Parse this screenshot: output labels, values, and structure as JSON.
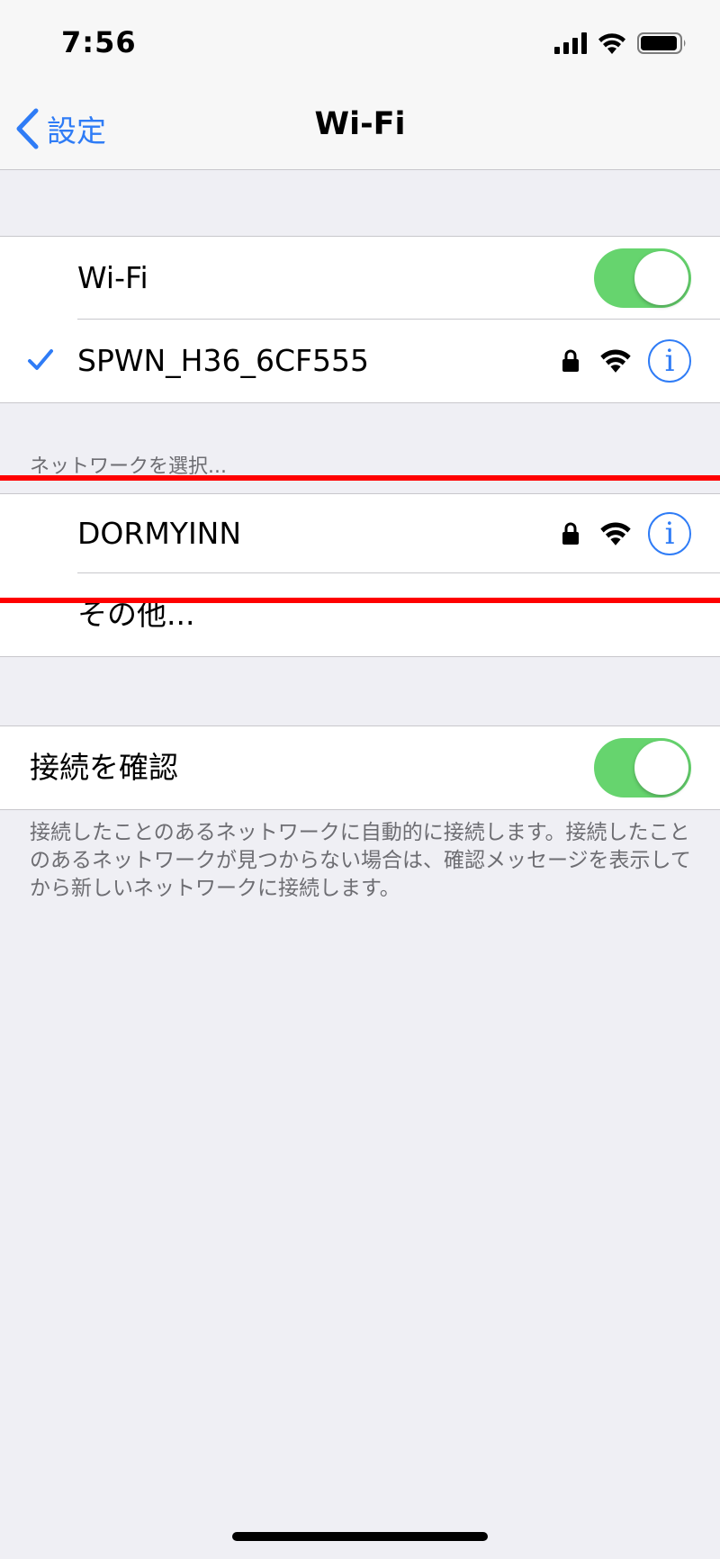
{
  "status_bar": {
    "time": "7:56",
    "icons": [
      "cellular-signal-icon",
      "wifi-icon",
      "battery-icon"
    ]
  },
  "nav": {
    "back_label": "設定",
    "title": "Wi-Fi"
  },
  "wifi_toggle": {
    "label": "Wi-Fi",
    "on": true
  },
  "connected_network": {
    "name": "SPWN_H36_6CF555",
    "icons": [
      "checkmark-icon",
      "lock-icon",
      "wifi-signal-icon",
      "info-icon"
    ]
  },
  "networks_header": "ネットワークを選択...",
  "networks": [
    {
      "name": "DORMYINN",
      "icons": [
        "lock-icon",
        "wifi-signal-icon",
        "info-icon"
      ]
    }
  ],
  "other_label": "その他...",
  "ask_to_join": {
    "label": "接続を確認",
    "on": true,
    "note": "接続したことのあるネットワークに自動的に接続します。接続したことのあるネットワークが見つからない場合は、確認メッセージを表示してから新しいネットワークに接続します。"
  },
  "colors": {
    "accent": "#2f7cf6",
    "toggle_on": "#66d46e",
    "annotation_red": "#ff0000",
    "background": "#efeff4"
  }
}
